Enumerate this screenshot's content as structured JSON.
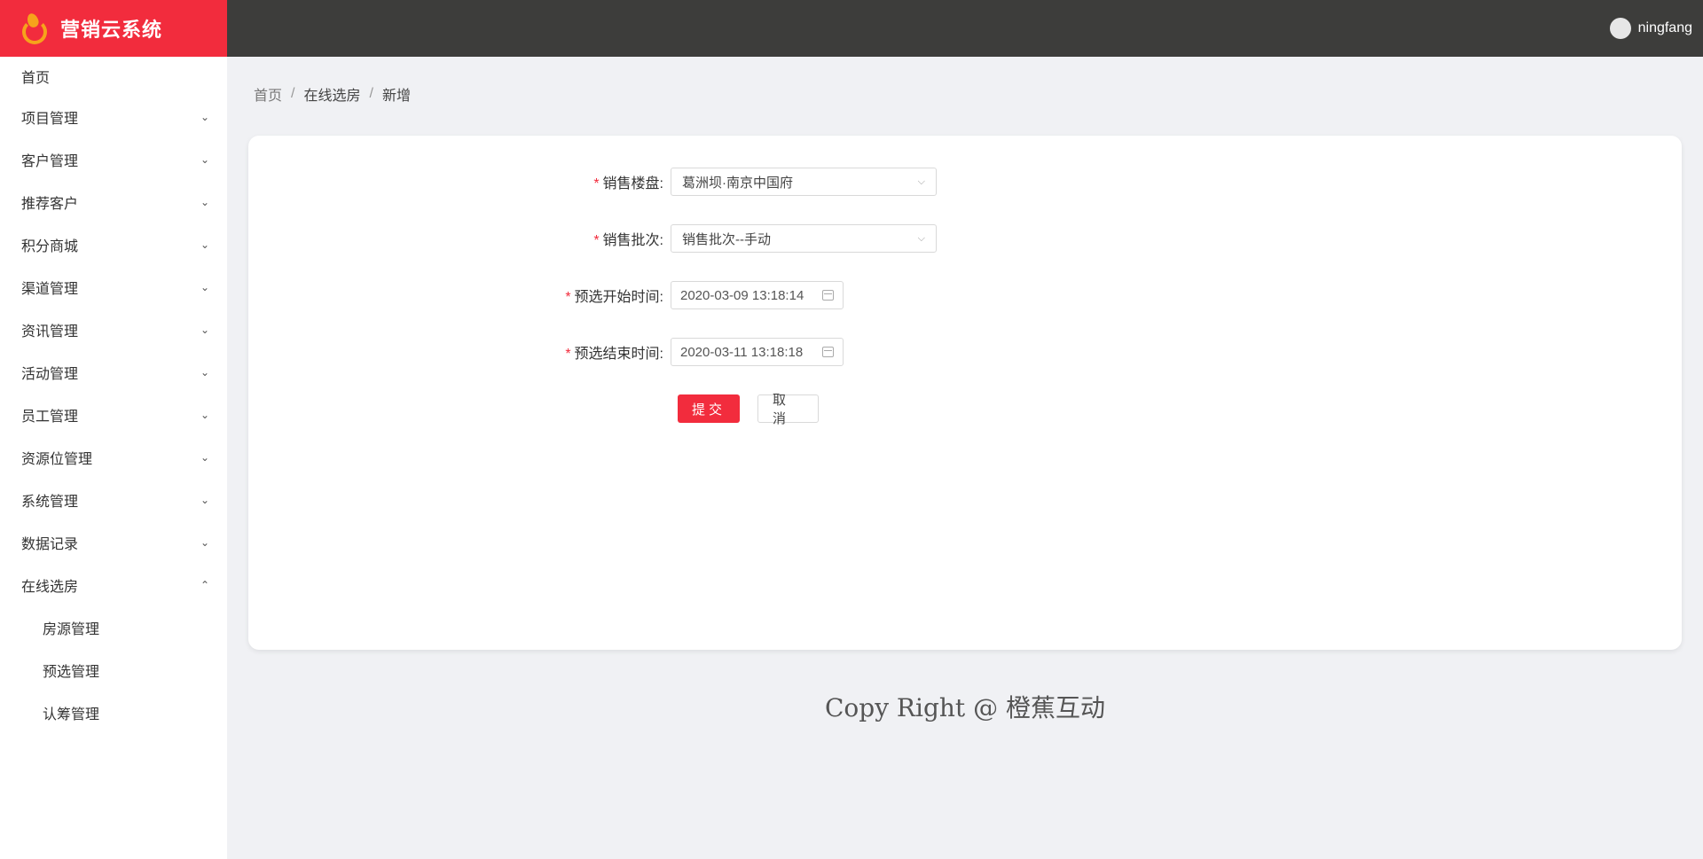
{
  "brand": {
    "title": "营销云系统",
    "logo_icon": "orange-logo-icon"
  },
  "header": {
    "username": "ningfang",
    "avatar_icon": "user-avatar-icon"
  },
  "sidebar": {
    "items": [
      {
        "label": "首页"
      },
      {
        "label": "项目管理"
      },
      {
        "label": "客户管理"
      },
      {
        "label": "推荐客户"
      },
      {
        "label": "积分商城"
      },
      {
        "label": "渠道管理"
      },
      {
        "label": "资讯管理"
      },
      {
        "label": "活动管理"
      },
      {
        "label": "员工管理"
      },
      {
        "label": "资源位管理"
      },
      {
        "label": "系统管理"
      },
      {
        "label": "数据记录"
      },
      {
        "label": "在线选房"
      }
    ],
    "submenu": [
      {
        "label": "房源管理"
      },
      {
        "label": "预选管理"
      },
      {
        "label": "认筹管理"
      }
    ],
    "chevron_down": "⌄",
    "chevron_up": "⌃"
  },
  "breadcrumb": {
    "home": "首页",
    "section": "在线选房",
    "current": "新增",
    "sep": "/"
  },
  "form": {
    "required_mark": "*",
    "project": {
      "label": "销售楼盘:",
      "value": "葛洲坝·南京中国府"
    },
    "batch": {
      "label": "销售批次:",
      "value": "销售批次--手动"
    },
    "start_time": {
      "label": "预选开始时间:",
      "value": "2020-03-09 13:18:14"
    },
    "end_time": {
      "label": "预选结束时间:",
      "value": "2020-03-11 13:18:18"
    },
    "caret": "⌵"
  },
  "actions": {
    "submit": "提交",
    "cancel": "取消"
  },
  "footer": {
    "text": "Copy Right @ 橙蕉互动"
  },
  "colors": {
    "brand": "#f22c3d",
    "topbar": "#3d3d3b",
    "accent": "#f6a31b"
  }
}
